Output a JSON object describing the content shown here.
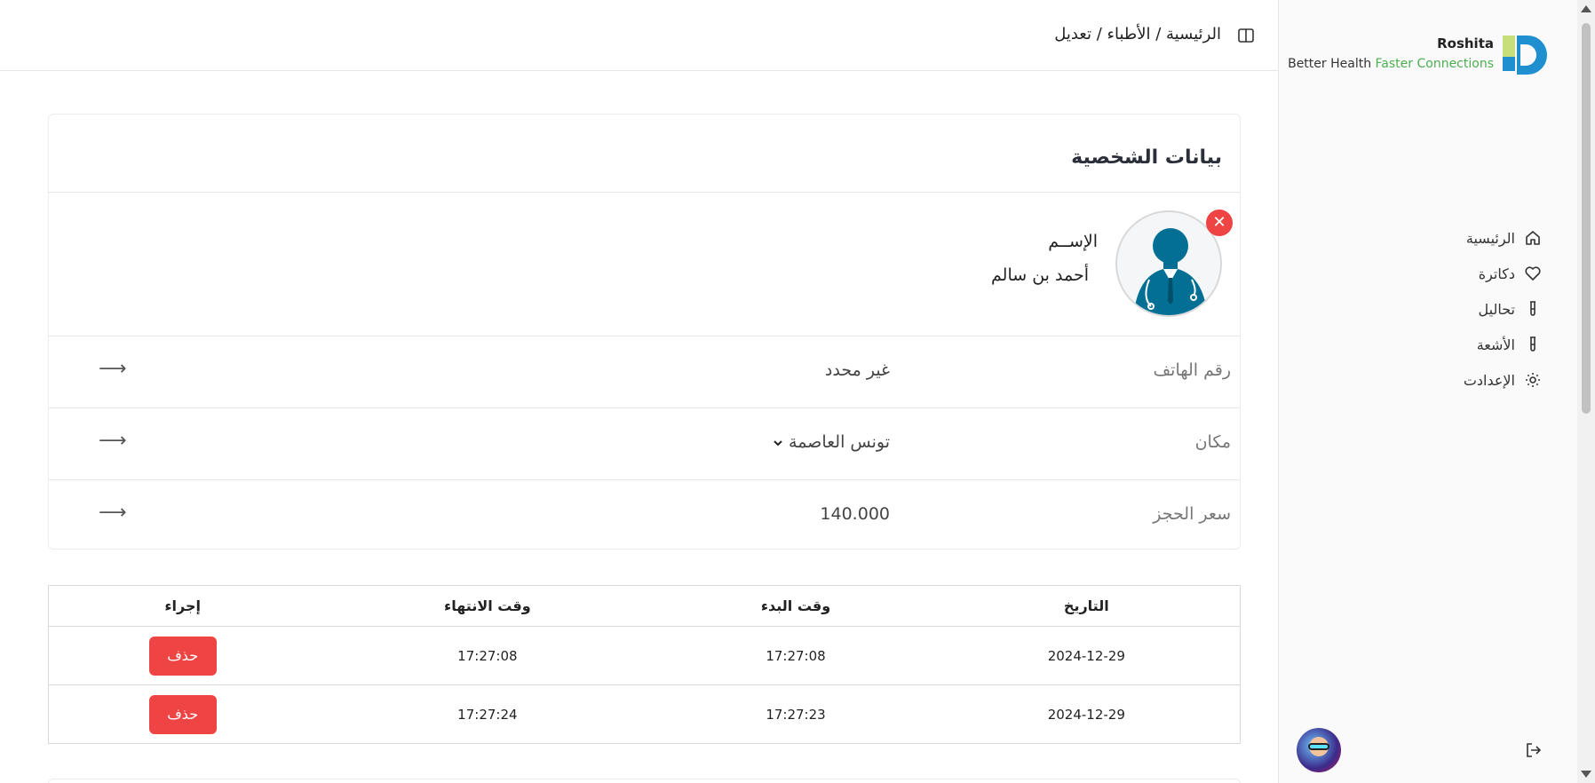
{
  "brand": {
    "name": "Roshita",
    "tagline_prefix": "Better Health ",
    "tagline_accent": "Faster Connections",
    "accent_color": "#4caf50",
    "logo_color": "#1f8fd0"
  },
  "breadcrumb": "الرئيسية / الأطباء / تعديل",
  "sidebar": {
    "items": [
      {
        "label": "الرئيسية",
        "icon": "home-icon"
      },
      {
        "label": "دكاترة",
        "icon": "heart-icon"
      },
      {
        "label": "تحاليل",
        "icon": "test-tube-icon"
      },
      {
        "label": "الأشعة",
        "icon": "test-tube-icon"
      },
      {
        "label": "الإعدادت",
        "icon": "gear-icon"
      }
    ]
  },
  "profile": {
    "title": "بيانات الشخصية",
    "name_label": "الإســم",
    "name_value": "أحمد بن سالم",
    "remove_icon": "close-icon"
  },
  "fields": [
    {
      "label": "رقم الهاتف",
      "value": "غير محدد"
    },
    {
      "label": "مكان",
      "value": "تونس العاصمة"
    },
    {
      "label": "سعر الحجز",
      "value": "140.000"
    }
  ],
  "schedule": {
    "headers": [
      "التاريخ",
      "وقت البدء",
      "وقت الانتهاء",
      "إجراء"
    ],
    "rows": [
      {
        "date": "2024-12-29",
        "start": "17:27:08",
        "end": "17:27:08",
        "action": "حذف"
      },
      {
        "date": "2024-12-29",
        "start": "17:27:23",
        "end": "17:27:24",
        "action": "حذف"
      }
    ]
  },
  "colors": {
    "danger": "#ef4444"
  }
}
